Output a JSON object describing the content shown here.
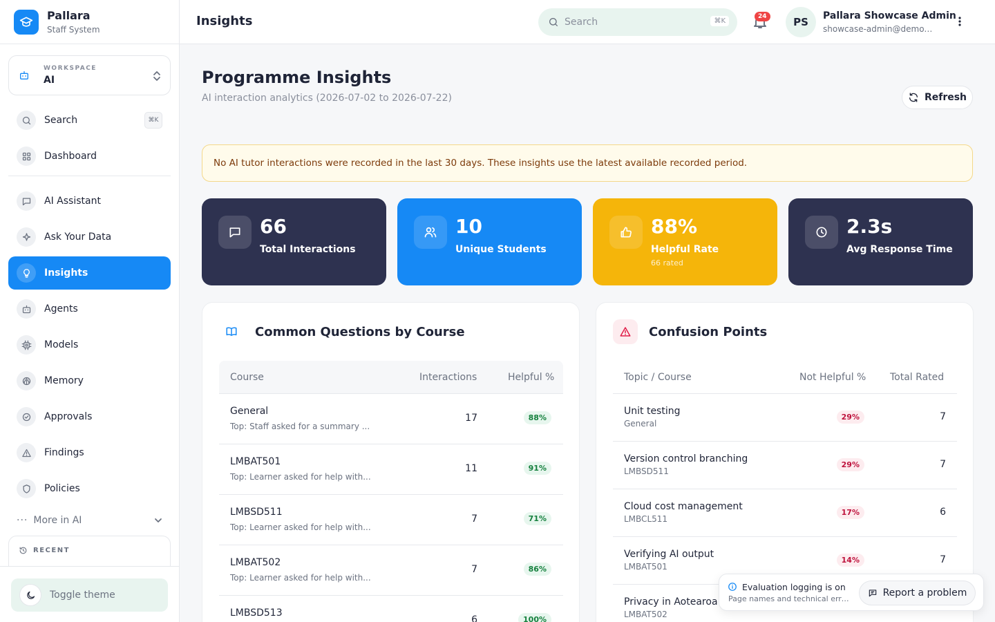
{
  "brand": {
    "name": "Pallara",
    "subtitle": "Staff System"
  },
  "workspace": {
    "label": "WORKSPACE",
    "value": "AI"
  },
  "sidebar": {
    "search_label": "Search",
    "search_shortcut": "⌘K",
    "items": [
      {
        "label": "Dashboard"
      },
      {
        "label": "AI Assistant"
      },
      {
        "label": "Ask Your Data"
      },
      {
        "label": "Insights"
      },
      {
        "label": "Agents"
      },
      {
        "label": "Models"
      },
      {
        "label": "Memory"
      },
      {
        "label": "Approvals"
      },
      {
        "label": "Findings"
      },
      {
        "label": "Policies"
      }
    ],
    "more_label": "More in AI",
    "recent_label": "RECENT",
    "toggle_theme": "Toggle theme"
  },
  "header": {
    "title": "Insights",
    "search_placeholder": "Search",
    "search_shortcut": "⌘K",
    "notification_count": "24",
    "avatar_initials": "PS",
    "user_name": "Pallara Showcase Admin",
    "user_email": "showcase-admin@demo.pallara.edu"
  },
  "main": {
    "title": "Programme Insights",
    "subtitle": "AI interaction analytics (2026-07-02 to 2026-07-22)",
    "refresh_label": "Refresh",
    "notice": "No AI tutor interactions were recorded in the last 30 days. These insights use the latest available recorded period."
  },
  "stats": [
    {
      "value": "66",
      "label": "Total Interactions",
      "sub": "",
      "color": "#2e3250"
    },
    {
      "value": "10",
      "label": "Unique Students",
      "sub": "",
      "color": "#1689f5"
    },
    {
      "value": "88%",
      "label": "Helpful Rate",
      "sub": "66 rated",
      "color": "#f5b50a"
    },
    {
      "value": "2.3s",
      "label": "Avg Response Time",
      "sub": "",
      "color": "#2e3250"
    }
  ],
  "questions": {
    "title": "Common Questions by Course",
    "headers": {
      "course": "Course",
      "interactions": "Interactions",
      "helpful": "Helpful %"
    },
    "rows": [
      {
        "course": "General",
        "top": "Top: Staff asked for a summary ...",
        "interactions": "17",
        "helpful": "88%"
      },
      {
        "course": "LMBAT501",
        "top": "Top: Learner asked for help with...",
        "interactions": "11",
        "helpful": "91%"
      },
      {
        "course": "LMBSD511",
        "top": "Top: Learner asked for help with...",
        "interactions": "7",
        "helpful": "71%"
      },
      {
        "course": "LMBAT502",
        "top": "Top: Learner asked for help with...",
        "interactions": "7",
        "helpful": "86%"
      },
      {
        "course": "LMBSD513",
        "top": "",
        "interactions": "6",
        "helpful": "100%"
      }
    ]
  },
  "confusion": {
    "title": "Confusion Points",
    "headers": {
      "topic": "Topic / Course",
      "not_helpful": "Not Helpful %",
      "total": "Total Rated"
    },
    "rows": [
      {
        "topic": "Unit testing",
        "course": "General",
        "not_helpful": "29%",
        "total": "7"
      },
      {
        "topic": "Version control branching",
        "course": "LMBSD511",
        "not_helpful": "29%",
        "total": "7"
      },
      {
        "topic": "Cloud cost management",
        "course": "LMBCL511",
        "not_helpful": "17%",
        "total": "6"
      },
      {
        "topic": "Verifying AI output",
        "course": "LMBAT501",
        "not_helpful": "14%",
        "total": "7"
      },
      {
        "topic": "Privacy in Aotearoa",
        "course": "LMBAT502",
        "not_helpful": "",
        "total": ""
      }
    ]
  },
  "toast": {
    "title": "Evaluation logging is on",
    "subtitle": "Page names and technical errors are logged.",
    "report_label": "Report a problem"
  }
}
